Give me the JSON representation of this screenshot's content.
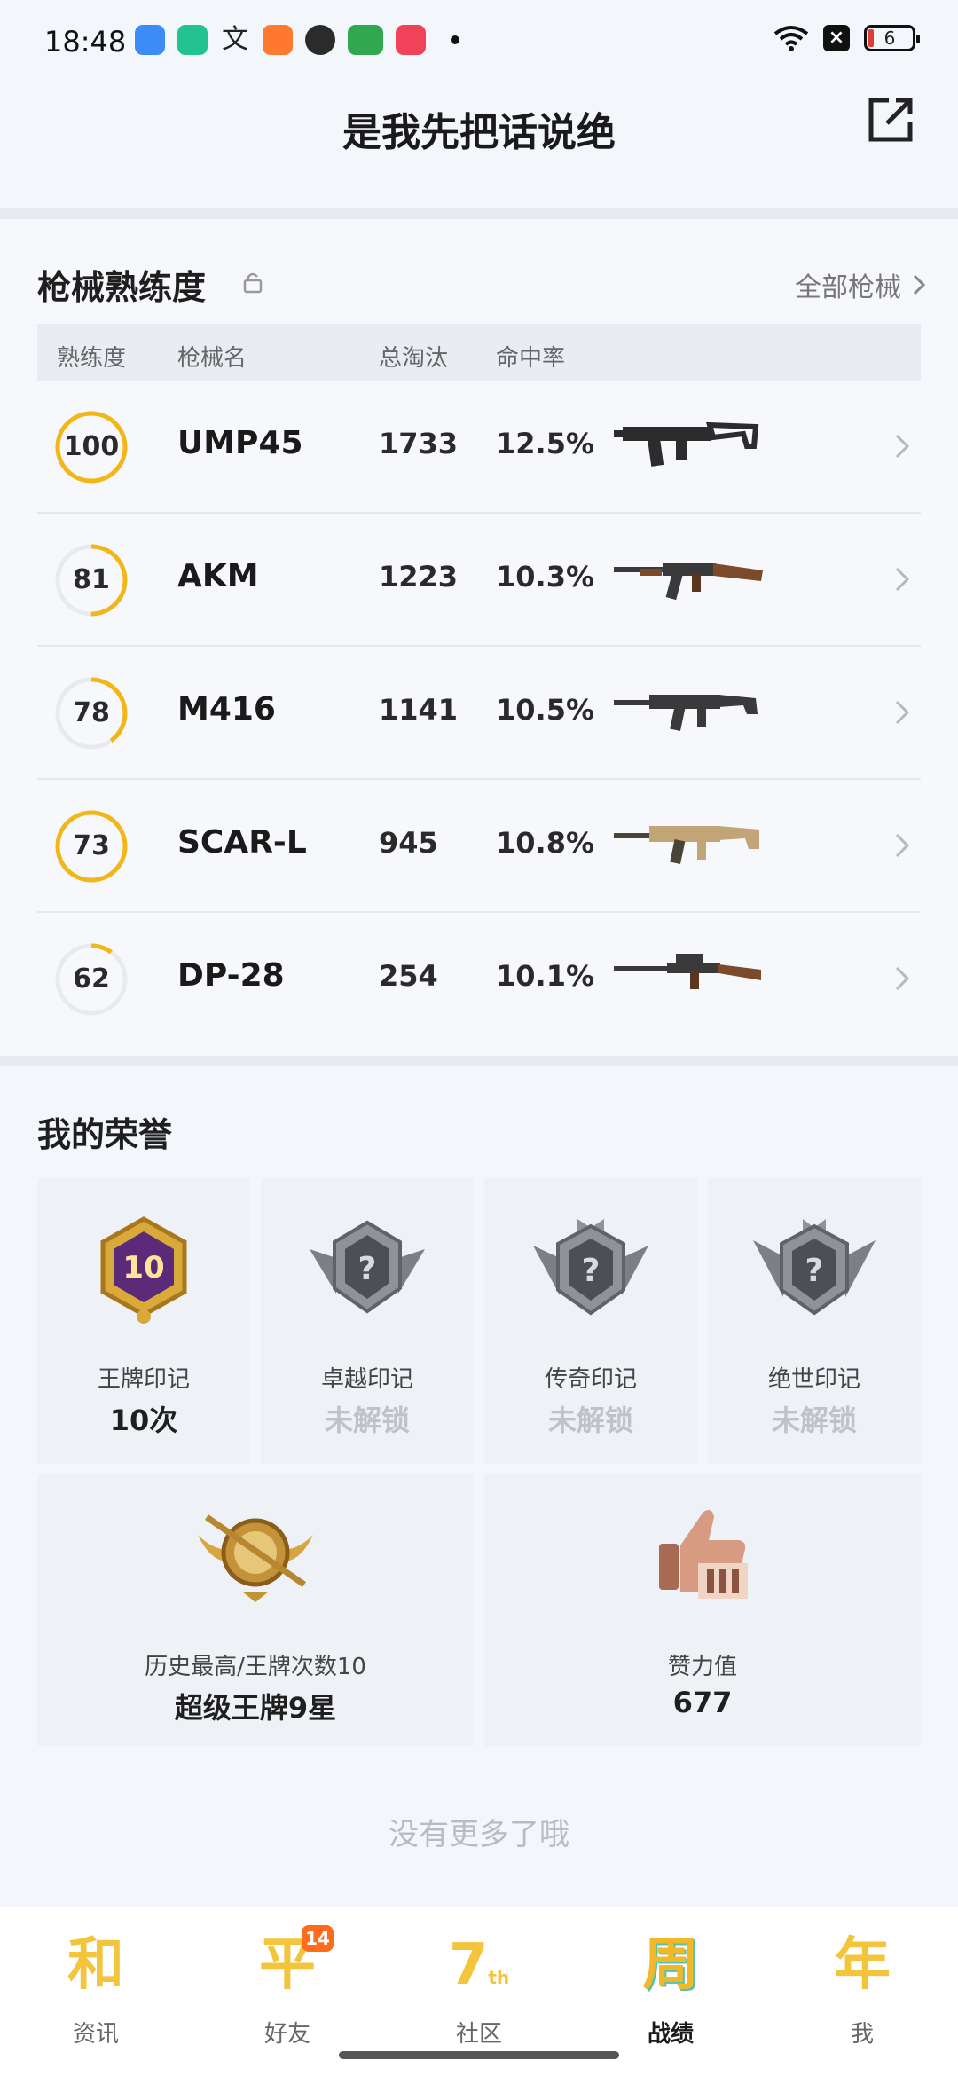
{
  "status_bar": {
    "time": "18:48",
    "battery_level": "6",
    "icons": [
      "files-app-icon",
      "phone-manager-icon",
      "alipay-icon",
      "game-app-icon",
      "wechat-icon",
      "oppo-store-icon",
      "video-app-icon"
    ]
  },
  "header": {
    "title": "是我先把话说绝"
  },
  "mastery": {
    "title": "枪械熟练度",
    "all_link": "全部枪械",
    "columns": {
      "mastery": "熟练度",
      "name": "枪械名",
      "kills": "总淘汰",
      "hit_rate": "命中率"
    },
    "rows": [
      {
        "mastery": "100",
        "progress": 1.0,
        "name": "UMP45",
        "kills": "1733",
        "hit_rate": "12.5%"
      },
      {
        "mastery": "81",
        "progress": 0.5,
        "name": "AKM",
        "kills": "1223",
        "hit_rate": "10.3%"
      },
      {
        "mastery": "78",
        "progress": 0.4,
        "name": "M416",
        "kills": "1141",
        "hit_rate": "10.5%"
      },
      {
        "mastery": "73",
        "progress": 1.0,
        "name": "SCAR-L",
        "kills": "945",
        "hit_rate": "10.8%"
      },
      {
        "mastery": "62",
        "progress": 0.1,
        "name": "DP-28",
        "kills": "254",
        "hit_rate": "10.1%"
      }
    ]
  },
  "honors": {
    "title": "我的荣誉",
    "badges": [
      {
        "label": "王牌印记",
        "value": "10次",
        "badge_text": "10"
      },
      {
        "label": "卓越印记",
        "value": "未解锁"
      },
      {
        "label": "传奇印记",
        "value": "未解锁"
      },
      {
        "label": "绝世印记",
        "value": "未解锁"
      }
    ],
    "highest": {
      "label": "历史最高/王牌次数10",
      "value": "超级王牌9星"
    },
    "likes": {
      "label": "赞力值",
      "value": "677"
    }
  },
  "footer": {
    "no_more": "没有更多了哦"
  },
  "nav": {
    "items": [
      {
        "label": "资讯",
        "glyph": "和"
      },
      {
        "label": "好友",
        "glyph": "平",
        "badge": "14"
      },
      {
        "label": "社区",
        "glyph": "7",
        "glyph_sup": "th"
      },
      {
        "label": "战绩",
        "glyph": "周"
      },
      {
        "label": "我",
        "glyph": "年"
      }
    ],
    "active_index": 3
  },
  "colors": {
    "accent_gold": "#f3b617",
    "ring_track": "#e7ebf0",
    "badge_orange": "#ff6b1a"
  }
}
